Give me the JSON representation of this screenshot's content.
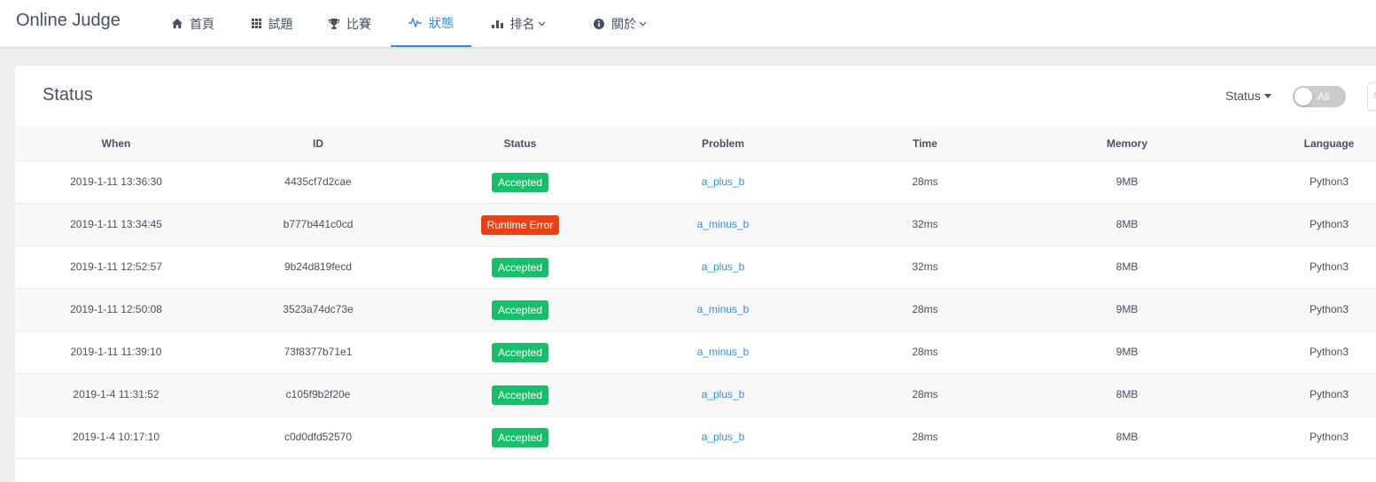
{
  "header": {
    "logo": "Online Judge",
    "nav": [
      {
        "label": "首頁",
        "icon": "home-icon"
      },
      {
        "label": "試題",
        "icon": "grid-icon"
      },
      {
        "label": "比賽",
        "icon": "trophy-icon"
      },
      {
        "label": "狀態",
        "icon": "pulse-icon",
        "active": true
      },
      {
        "label": "排名",
        "icon": "bar-chart-icon",
        "dropdown": true
      },
      {
        "label": "關於",
        "icon": "info-icon",
        "dropdown": true
      }
    ]
  },
  "card": {
    "title": "Status",
    "filter_label": "Status",
    "toggle_label": "All",
    "search_placeholder": "S"
  },
  "table": {
    "columns": [
      "When",
      "ID",
      "Status",
      "Problem",
      "Time",
      "Memory",
      "Language"
    ],
    "rows": [
      {
        "when": "2019-1-11 13:36:30",
        "id": "4435cf7d2cae",
        "status": "Accepted",
        "problem": "a_plus_b",
        "time": "28ms",
        "memory": "9MB",
        "language": "Python3"
      },
      {
        "when": "2019-1-11 13:34:45",
        "id": "b777b441c0cd",
        "status": "Runtime Error",
        "problem": "a_minus_b",
        "time": "32ms",
        "memory": "8MB",
        "language": "Python3"
      },
      {
        "when": "2019-1-11 12:52:57",
        "id": "9b24d819fecd",
        "status": "Accepted",
        "problem": "a_plus_b",
        "time": "32ms",
        "memory": "8MB",
        "language": "Python3"
      },
      {
        "when": "2019-1-11 12:50:08",
        "id": "3523a74dc73e",
        "status": "Accepted",
        "problem": "a_minus_b",
        "time": "28ms",
        "memory": "9MB",
        "language": "Python3"
      },
      {
        "when": "2019-1-11 11:39:10",
        "id": "73f8377b71e1",
        "status": "Accepted",
        "problem": "a_minus_b",
        "time": "28ms",
        "memory": "9MB",
        "language": "Python3"
      },
      {
        "when": "2019-1-4 11:31:52",
        "id": "c105f9b2f20e",
        "status": "Accepted",
        "problem": "a_plus_b",
        "time": "28ms",
        "memory": "8MB",
        "language": "Python3"
      },
      {
        "when": "2019-1-4 10:17:10",
        "id": "c0d0dfd52570",
        "status": "Accepted",
        "problem": "a_plus_b",
        "time": "28ms",
        "memory": "8MB",
        "language": "Python3"
      }
    ]
  },
  "colors": {
    "accent": "#2d8cf0",
    "accepted": "#19be6b",
    "runtime_error": "#ed3f14"
  }
}
